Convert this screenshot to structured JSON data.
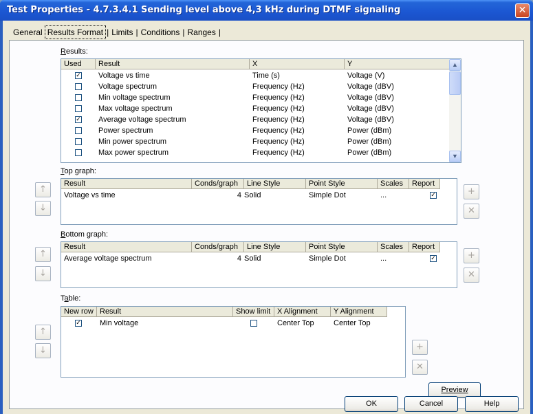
{
  "window": {
    "title": "Test Properties - 4.7.3.4.1 Sending level above 4,3 kHz during DTMF signaling",
    "close_glyph": "✕"
  },
  "tabs": [
    "General",
    "Results Format",
    "Limits",
    "Conditions",
    "Ranges"
  ],
  "active_tab": "Results Format",
  "results": {
    "label": "Results:",
    "accel": "R",
    "columns": [
      "Used",
      "Result",
      "X",
      "Y"
    ],
    "rows": [
      {
        "used": true,
        "result": "Voltage vs time",
        "x": "Time (s)",
        "y": "Voltage (V)"
      },
      {
        "used": false,
        "result": "Voltage spectrum",
        "x": "Frequency (Hz)",
        "y": "Voltage (dBV)"
      },
      {
        "used": false,
        "result": "Min voltage spectrum",
        "x": "Frequency (Hz)",
        "y": "Voltage (dBV)"
      },
      {
        "used": false,
        "result": "Max voltage spectrum",
        "x": "Frequency (Hz)",
        "y": "Voltage (dBV)"
      },
      {
        "used": true,
        "result": "Average voltage spectrum",
        "x": "Frequency (Hz)",
        "y": "Voltage (dBV)"
      },
      {
        "used": false,
        "result": "Power spectrum",
        "x": "Frequency (Hz)",
        "y": "Power (dBm)"
      },
      {
        "used": false,
        "result": "Min power spectrum",
        "x": "Frequency (Hz)",
        "y": "Power (dBm)"
      },
      {
        "used": false,
        "result": "Max power spectrum",
        "x": "Frequency (Hz)",
        "y": "Power (dBm)"
      }
    ]
  },
  "top_graph": {
    "label": "Top graph:",
    "accel": "T",
    "columns": [
      "Result",
      "Conds/graph",
      "Line Style",
      "Point Style",
      "Scales",
      "Report"
    ],
    "row": {
      "result": "Voltage vs time",
      "conds": "4",
      "line_style": "Solid",
      "point_style": "Simple Dot",
      "scales": "...",
      "report": true
    }
  },
  "bottom_graph": {
    "label": "Bottom graph:",
    "accel": "B",
    "columns": [
      "Result",
      "Conds/graph",
      "Line Style",
      "Point Style",
      "Scales",
      "Report"
    ],
    "row": {
      "result": "Average voltage spectrum",
      "conds": "4",
      "line_style": "Solid",
      "point_style": "Simple Dot",
      "scales": "...",
      "report": true
    }
  },
  "table": {
    "label": "Table:",
    "accel": "a",
    "columns": [
      "New row",
      "Result",
      "Show limit",
      "X Alignment",
      "Y Alignment"
    ],
    "row": {
      "new_row": true,
      "result": "Min voltage",
      "show_limit": false,
      "x_align": "Center Top",
      "y_align": "Center Top"
    }
  },
  "icons": {
    "up": "↑",
    "down": "↓",
    "add": "+",
    "remove": "✕",
    "scroll_up": "▲",
    "scroll_down": "▼",
    "checked": "✓"
  },
  "buttons": {
    "preview": "Preview",
    "ok": "OK",
    "cancel": "Cancel",
    "help": "Help"
  }
}
